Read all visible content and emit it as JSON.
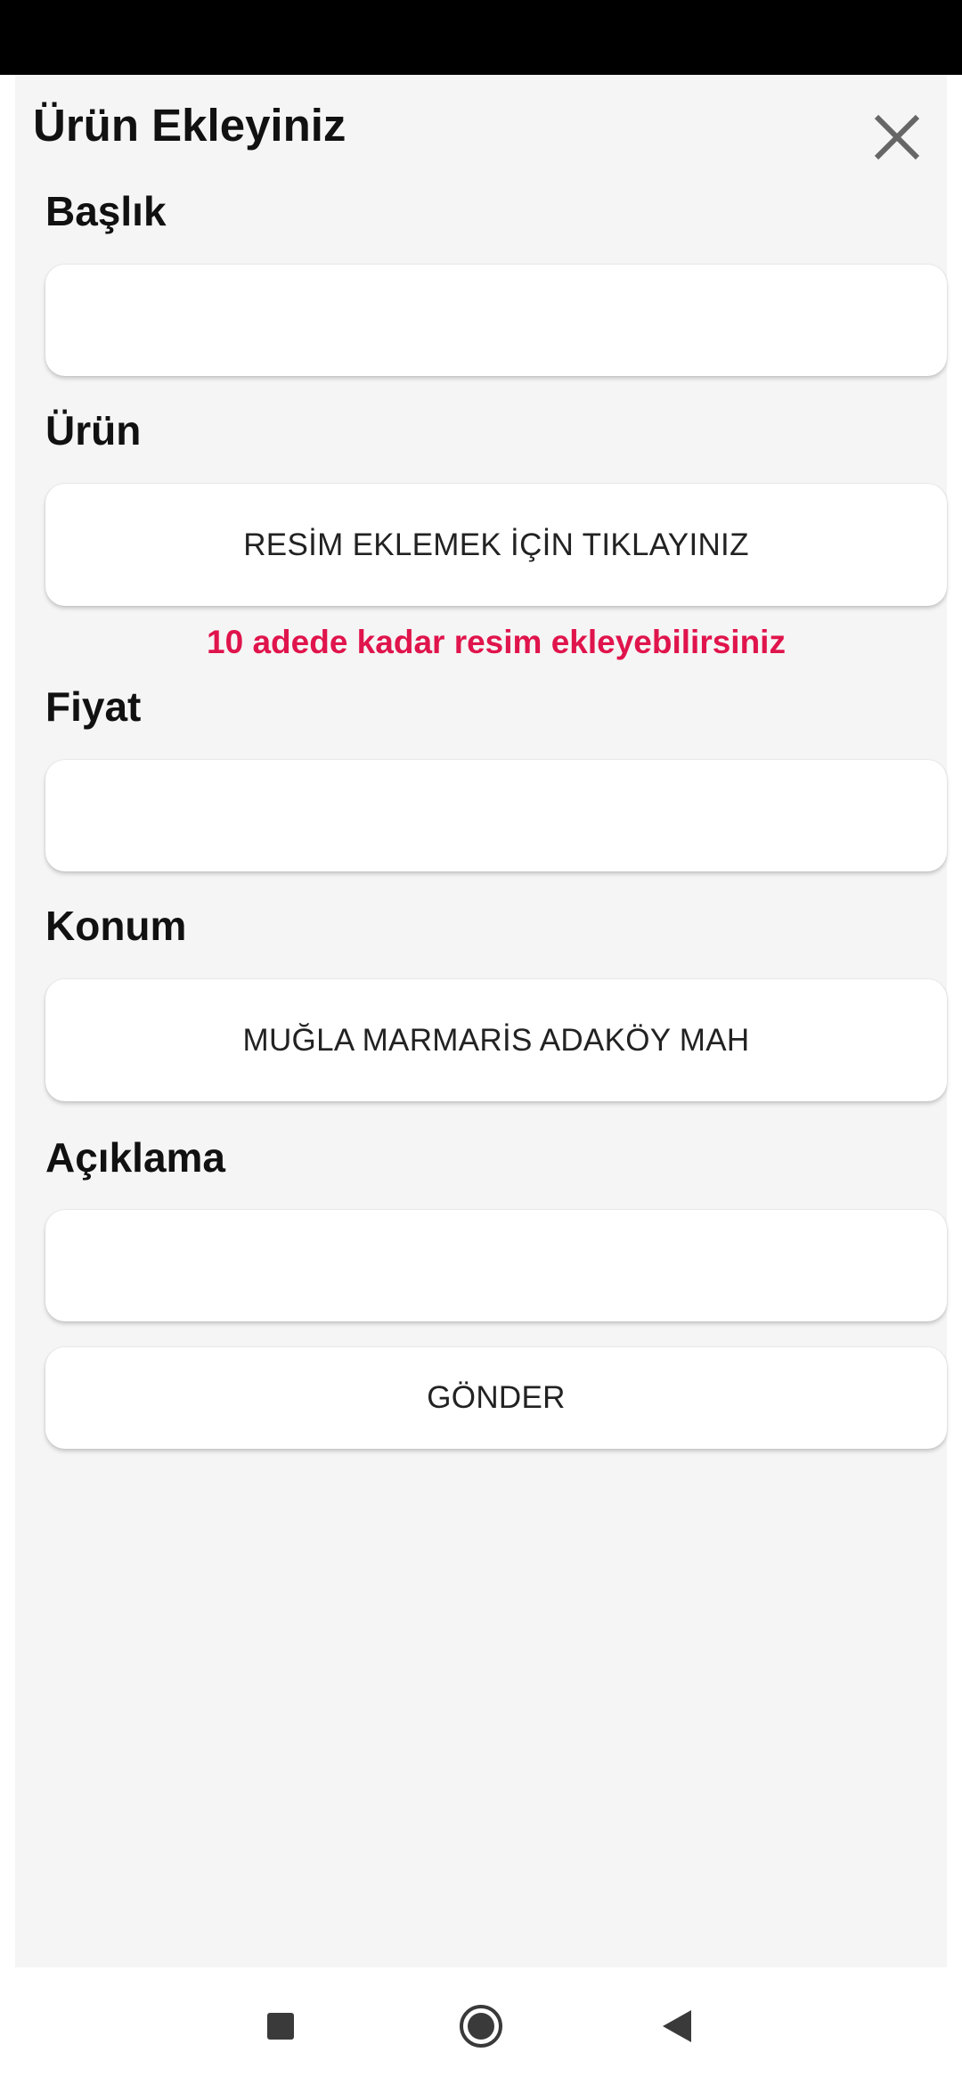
{
  "header": {
    "title": "Ürün Ekleyiniz"
  },
  "form": {
    "title_label": "Başlık",
    "title_value": "",
    "product_label": "Ürün",
    "add_image_button": "RESİM EKLEMEK İÇİN TIKLAYINIZ",
    "image_hint": "10 adede kadar resim ekleyebilirsiniz",
    "price_label": "Fiyat",
    "price_value": "",
    "location_label": "Konum",
    "location_value": "MUĞLA MARMARİS ADAKÖY MAH",
    "description_label": "Açıklama",
    "description_value": "",
    "submit_button": "GÖNDER"
  },
  "colors": {
    "accent_hint": "#e0144c",
    "panel_background": "#f5f5f5",
    "status_bar": "#000000"
  },
  "icons": {
    "close": "close-icon",
    "nav_recents": "square-icon",
    "nav_home": "circle-icon",
    "nav_back": "triangle-back-icon"
  }
}
